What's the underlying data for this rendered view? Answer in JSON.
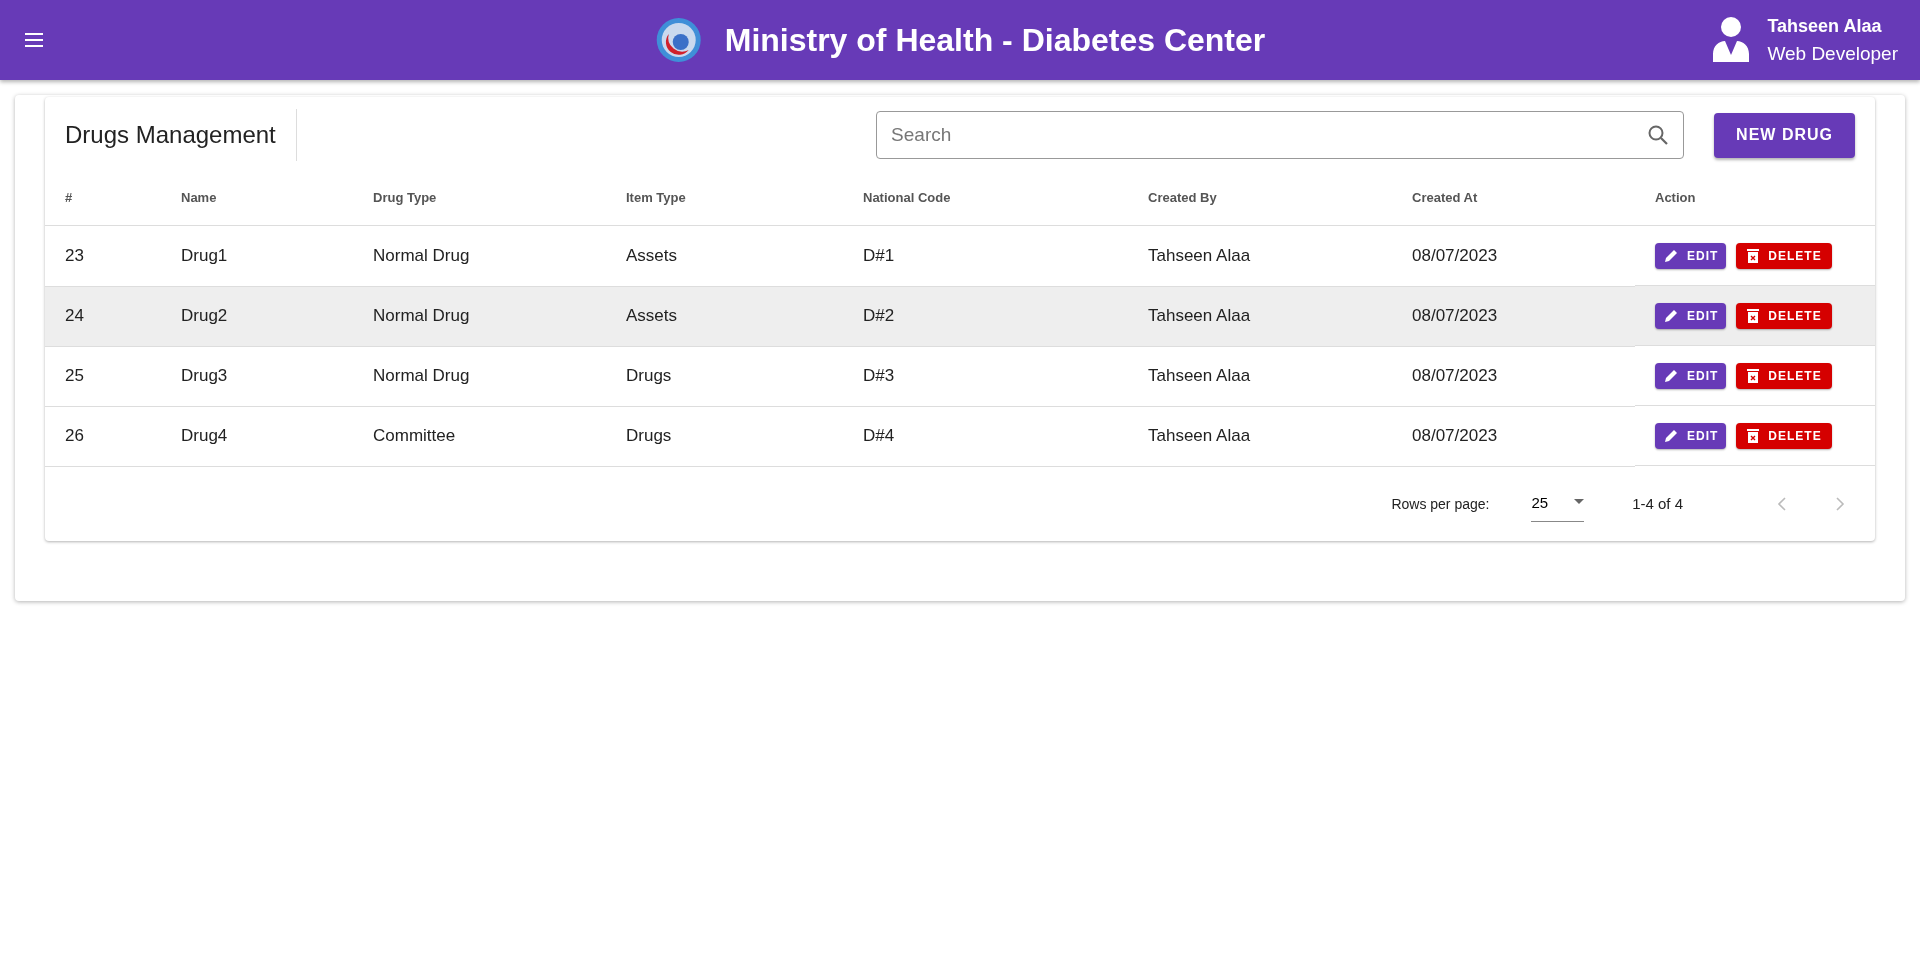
{
  "header": {
    "title": "Ministry of Health - Diabetes Center",
    "user": {
      "name": "Tahseen Alaa",
      "role": "Web Developer"
    }
  },
  "panel": {
    "title": "Drugs Management",
    "search": {
      "placeholder": "Search"
    },
    "new_button": "NEW DRUG"
  },
  "table": {
    "columns": [
      "#",
      "Name",
      "Drug Type",
      "Item Type",
      "National Code",
      "Created By",
      "Created At",
      "Action"
    ],
    "rows": [
      {
        "cells": [
          "23",
          "Drug1",
          "Normal Drug",
          "Assets",
          "D#1",
          "Tahseen Alaa",
          "08/07/2023"
        ],
        "selected": false,
        "actions": [
          "EDIT",
          "DELETE"
        ]
      },
      {
        "cells": [
          "24",
          "Drug2",
          "Normal Drug",
          "Assets",
          "D#2",
          "Tahseen Alaa",
          "08/07/2023"
        ],
        "selected": true,
        "actions": [
          "EDIT",
          "DELETE"
        ]
      },
      {
        "cells": [
          "25",
          "Drug3",
          "Normal Drug",
          "Drugs",
          "D#3",
          "Tahseen Alaa",
          "08/07/2023"
        ],
        "selected": false,
        "actions": [
          "EDIT",
          "DELETE"
        ]
      },
      {
        "cells": [
          "26",
          "Drug4",
          "Committee",
          "Drugs",
          "D#4",
          "Tahseen Alaa",
          "08/07/2023"
        ],
        "selected": false,
        "actions": [
          "EDIT",
          "DELETE"
        ]
      }
    ]
  },
  "pagination": {
    "rows_per_page_label": "Rows per page:",
    "rows_per_page": "25",
    "range": "1-4 of 4",
    "prev": {
      "disabled": true
    },
    "next": {
      "disabled": true
    }
  }
}
